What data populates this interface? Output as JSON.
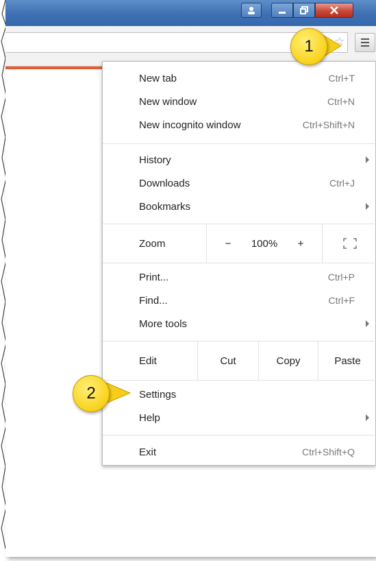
{
  "menu": {
    "group1": [
      {
        "label": "New tab",
        "shortcut": "Ctrl+T"
      },
      {
        "label": "New window",
        "shortcut": "Ctrl+N"
      },
      {
        "label": "New incognito window",
        "shortcut": "Ctrl+Shift+N"
      }
    ],
    "group2": [
      {
        "label": "History"
      },
      {
        "label": "Downloads",
        "shortcut": "Ctrl+J"
      },
      {
        "label": "Bookmarks"
      }
    ],
    "zoom": {
      "label": "Zoom",
      "minus": "−",
      "value": "100%",
      "plus": "+"
    },
    "group3": [
      {
        "label": "Print...",
        "shortcut": "Ctrl+P"
      },
      {
        "label": "Find...",
        "shortcut": "Ctrl+F"
      },
      {
        "label": "More tools"
      }
    ],
    "edit": {
      "label": "Edit",
      "cut": "Cut",
      "copy": "Copy",
      "paste": "Paste"
    },
    "group4": [
      {
        "label": "Settings"
      },
      {
        "label": "Help"
      }
    ],
    "exit": {
      "label": "Exit",
      "shortcut": "Ctrl+Shift+Q"
    }
  },
  "callouts": {
    "first": "1",
    "second": "2"
  },
  "icons": {
    "menu": "hamburger-icon",
    "bookmark": "star-icon",
    "fullscreen": "fullscreen-icon"
  },
  "colors": {
    "titlebar": "#3e6fb2",
    "close": "#c8483a",
    "accent_strip": "#e95b2e",
    "callout": "#f8d21c"
  }
}
